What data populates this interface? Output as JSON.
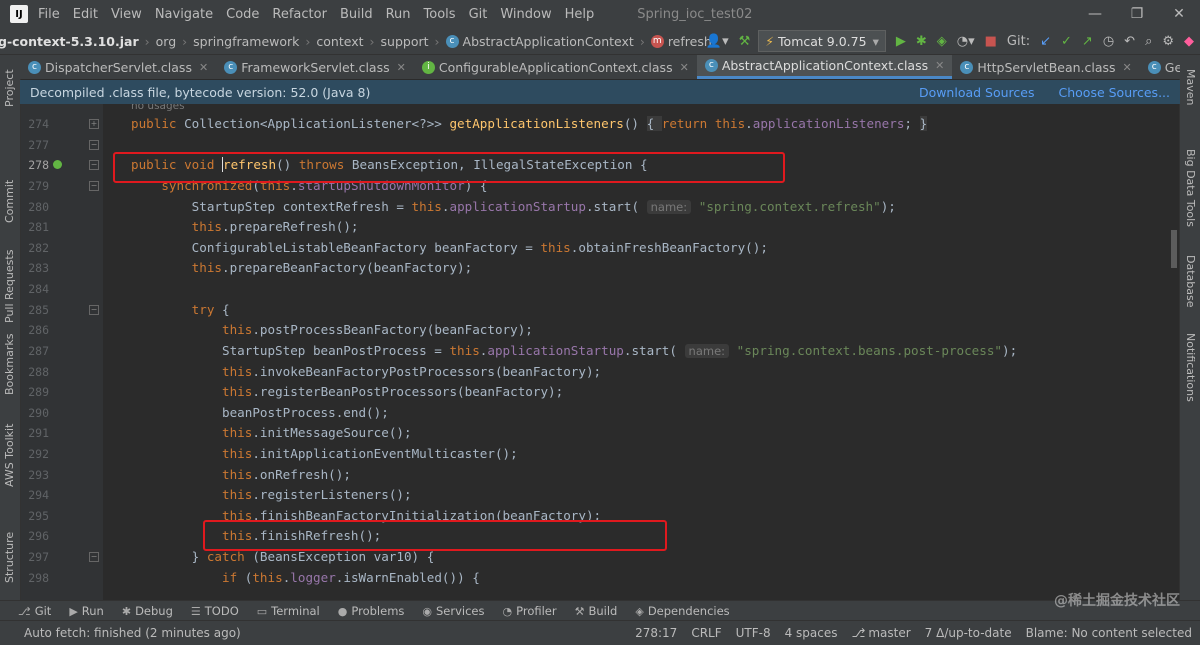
{
  "menubar": {
    "logo": "IJ",
    "items": [
      "File",
      "Edit",
      "View",
      "Navigate",
      "Code",
      "Refactor",
      "Build",
      "Run",
      "Tools",
      "Git",
      "Window",
      "Help"
    ],
    "window_title": "Spring_ioc_test02",
    "controls": [
      "—",
      "❐",
      "✕"
    ]
  },
  "navbar": {
    "jar": "g-context-5.3.10.jar",
    "path": [
      "org",
      "springframework",
      "context",
      "support"
    ],
    "class_name": "AbstractApplicationContext",
    "method": "refresh",
    "run_config": "Tomcat 9.0.75",
    "git_label": "Git:"
  },
  "tabs": [
    {
      "label": "DispatcherServlet.class",
      "active": false
    },
    {
      "label": "FrameworkServlet.class",
      "active": false
    },
    {
      "label": "ConfigurableApplicationContext.class",
      "active": false
    },
    {
      "label": "AbstractApplicationContext.class",
      "active": true
    },
    {
      "label": "HttpServletBean.class",
      "active": false
    },
    {
      "label": "GenericServlet.class",
      "active": false
    }
  ],
  "banner": {
    "text": "Decompiled .class file, bytecode version: 52.0 (Java 8)",
    "download_sources": "Download Sources",
    "choose_sources": "Choose Sources..."
  },
  "left_tools": [
    "Project",
    "Commit",
    "Pull Requests",
    "Bookmarks",
    "AWS Toolkit",
    "Structure"
  ],
  "right_tools": [
    "Maven",
    "Big Data Tools",
    "Database",
    "Notifications"
  ],
  "editor": {
    "usage_hint": "no usages",
    "line_numbers": [
      "274",
      "277",
      "278",
      "279",
      "280",
      "281",
      "282",
      "283",
      "284",
      "285",
      "286",
      "287",
      "288",
      "289",
      "290",
      "291",
      "292",
      "293",
      "294",
      "295",
      "296",
      "297",
      "298"
    ],
    "current_line": "278",
    "hint_name": "name:",
    "strings": {
      "ctx_refresh": "\"spring.context.refresh\"",
      "post_process": "\"spring.context.beans.post-process\""
    }
  },
  "bottom_tools": [
    {
      "icon": "⎇",
      "label": "Git"
    },
    {
      "icon": "▶",
      "label": "Run"
    },
    {
      "icon": "✱",
      "label": "Debug"
    },
    {
      "icon": "☰",
      "label": "TODO"
    },
    {
      "icon": "▭",
      "label": "Terminal"
    },
    {
      "icon": "●",
      "label": "Problems"
    },
    {
      "icon": "◉",
      "label": "Services"
    },
    {
      "icon": "◔",
      "label": "Profiler"
    },
    {
      "icon": "⚒",
      "label": "Build"
    },
    {
      "icon": "◈",
      "label": "Dependencies"
    }
  ],
  "status": {
    "message": "Auto fetch: finished (2 minutes ago)",
    "position": "278:17",
    "line_sep": "CRLF",
    "encoding": "UTF-8",
    "indent": "4 spaces",
    "branch": "master",
    "sync": "7 Δ/up-to-date",
    "vcs": "Blame: No content selected"
  },
  "watermark": "@稀土掘金技术社区",
  "colors": {
    "background": "#2b2b2b",
    "keyword": "#cc7832",
    "method": "#ffc66d",
    "field": "#9876aa",
    "string": "#6a8759",
    "highlight_box": "#e0191e"
  }
}
